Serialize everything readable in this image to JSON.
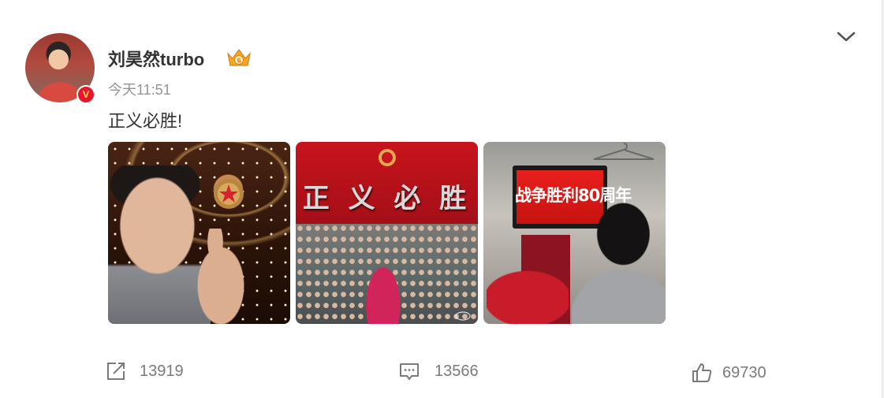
{
  "post": {
    "author": {
      "name": "刘昊然turbo",
      "verified_badge": "V",
      "member_badge_icon": "vip-crown-icon"
    },
    "timestamp": "今天11:51",
    "text": "正义必胜!",
    "images": [
      {
        "name": "photo-selfie-thumbs-up"
      },
      {
        "name": "photo-group-banner",
        "banner_text": "正 义 必 胜"
      },
      {
        "name": "photo-backstage-tv",
        "tv_text": "战争胜利80周年"
      }
    ]
  },
  "actions": {
    "repost": {
      "icon": "share-icon",
      "count": "13919"
    },
    "comment": {
      "icon": "comment-icon",
      "count": "13566"
    },
    "like": {
      "icon": "thumb-up-icon",
      "count": "69730"
    }
  },
  "menu": {
    "icon": "chevron-down-icon"
  },
  "colors": {
    "name_text": "#333333",
    "meta_text": "#939393",
    "count_text": "#7a7a7a",
    "verified_red": "#e6162d",
    "member_gold": "#f5a623"
  }
}
